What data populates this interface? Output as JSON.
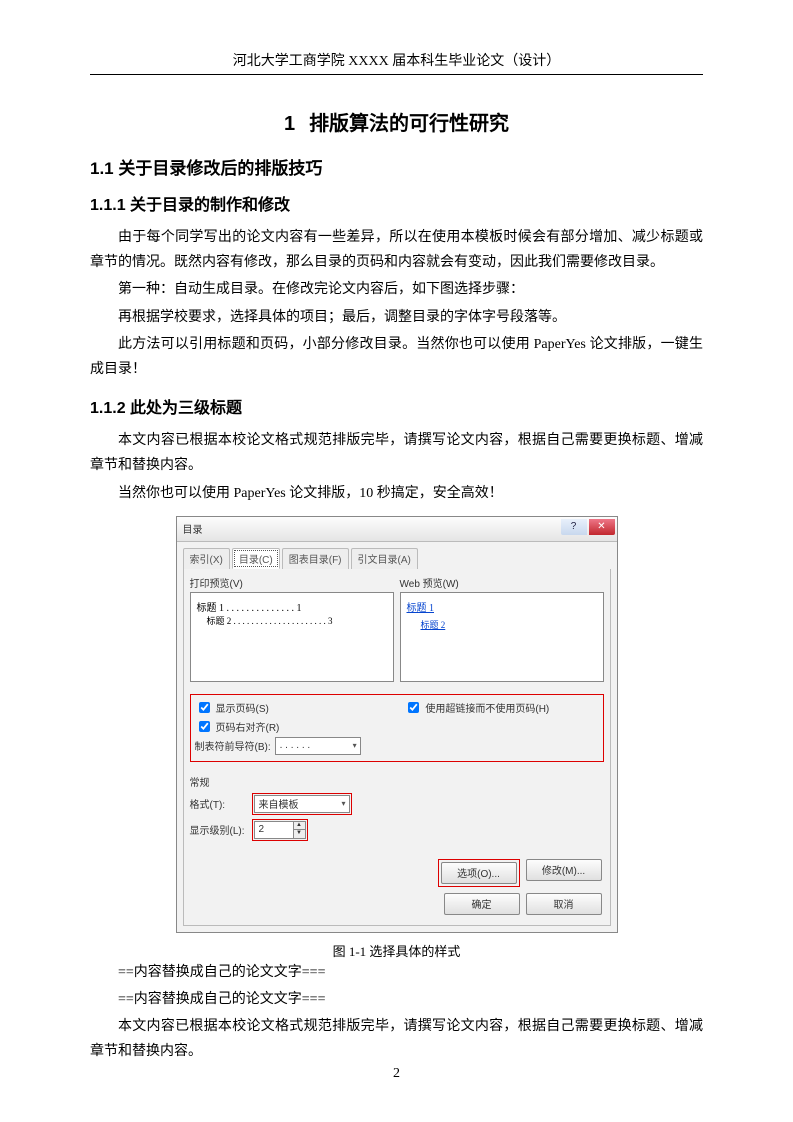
{
  "header": "河北大学工商学院 XXXX 届本科生毕业论文（设计）",
  "page_no": "2",
  "h1_no": "1",
  "h1_title": "排版算法的可行性研究",
  "h2_1": "1.1  关于目录修改后的排版技巧",
  "h3_1": "1.1.1  关于目录的制作和修改",
  "p1": "由于每个同学写出的论文内容有一些差异，所以在使用本模板时候会有部分增加、减少标题或章节的情况。既然内容有修改，那么目录的页码和内容就会有变动，因此我们需要修改目录。",
  "p2": "第一种：自动生成目录。在修改完论文内容后，如下图选择步骤：",
  "p3": "再根据学校要求，选择具体的项目；最后，调整目录的字体字号段落等。",
  "p4": "此方法可以引用标题和页码，小部分修改目录。当然你也可以使用 PaperYes 论文排版，一键生成目录！",
  "h3_2": "1.1.2  此处为三级标题",
  "p5": "本文内容已根据本校论文格式规范排版完毕，请撰写论文内容，根据自己需要更换标题、增减章节和替换内容。",
  "p6": "当然你也可以使用 PaperYes 论文排版，10 秒搞定，安全高效！",
  "figcap": "图 1-1    选择具体的样式",
  "p7": "==内容替换成自己的论文文字===",
  "p8": "==内容替换成自己的论文文字===",
  "p9": "本文内容已根据本校论文格式规范排版完毕，请撰写论文内容，根据自己需要更换标题、增减章节和替换内容。",
  "dialog": {
    "title": "目录",
    "tabs": [
      "索引(X)",
      "目录(C)",
      "图表目录(F)",
      "引文目录(A)"
    ],
    "print_preview_label": "打印预览(V)",
    "web_preview_label": "Web 预览(W)",
    "toc_line1": "标题 1 . . . . . . . . . . . . . . 1",
    "toc_line2": "标题 2 . . . . . . . . . . . . . . . . . . . . . 3",
    "web_link1": "标题 1",
    "web_link2": "标题 2",
    "chk_pageno": "显示页码(S)",
    "chk_right": "页码右对齐(R)",
    "chk_hyper": "使用超链接而不使用页码(H)",
    "leader_label": "制表符前导符(B):",
    "leader_value": ". . . . . .",
    "group_general": "常规",
    "format_label": "格式(T):",
    "format_value": "来自模板",
    "levels_label": "显示级别(L):",
    "levels_value": "2",
    "btn_options": "选项(O)...",
    "btn_modify": "修改(M)...",
    "btn_ok": "确定",
    "btn_cancel": "取消"
  }
}
